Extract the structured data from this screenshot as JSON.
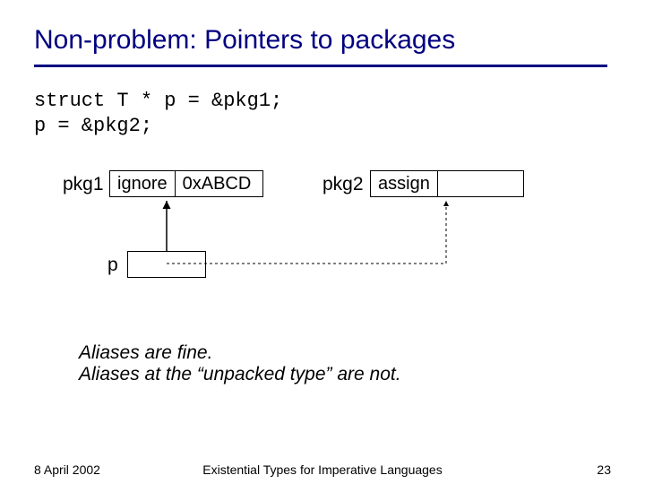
{
  "title": "Non-problem: Pointers to packages",
  "code_line1": "struct T * p = &pkg1;",
  "code_line2": "p = &pkg2;",
  "pkg1_label": "pkg1",
  "pkg1_cell1": "ignore",
  "pkg1_cell2": "0xABCD",
  "pkg2_label": "pkg2",
  "pkg2_cell1": "assign",
  "p_label": "p",
  "note_line1": "Aliases are fine.",
  "note_line2": "Aliases at the “unpacked type” are not.",
  "footer_date": "8 April 2002",
  "footer_title": "Existential Types for Imperative Languages",
  "footer_page": "23"
}
